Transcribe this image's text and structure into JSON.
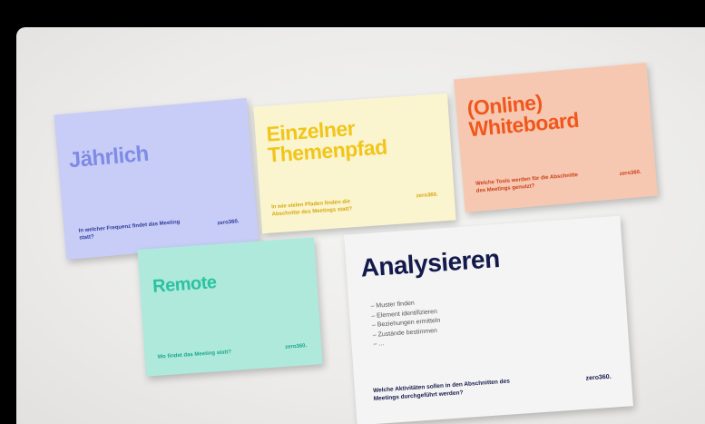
{
  "cards": [
    {
      "title": "Jährlich",
      "question": "In welcher Frequenz findet das Meeting statt?",
      "brand": "zero360.",
      "colors": {
        "background": "#c7cdf6",
        "accent": "#7f8be6"
      }
    },
    {
      "title": "Einzelner Themenpfad",
      "question": "In wie vielen Pfaden finden die Abschnitte des Meetings statt?",
      "brand": "zero360.",
      "colors": {
        "background": "#faf5cf",
        "accent": "#f1c51b"
      }
    },
    {
      "title": "(Online) Whiteboard",
      "question": "Welche Tools werden für die Abschnitte des Meetings genutzt?",
      "brand": "zero360.",
      "colors": {
        "background": "#f7c8b1",
        "accent": "#f0571c"
      }
    },
    {
      "title": "Remote",
      "question": "Wo findet das Meeting statt?",
      "brand": "zero360.",
      "colors": {
        "background": "#aee9dc",
        "accent": "#2bc29f"
      }
    },
    {
      "title": "Analysieren",
      "items": [
        "Muster finden",
        "Element identifizieren",
        "Beziehungen ermitteln",
        "Zustände bestimmen",
        "..."
      ],
      "question": "Welche Aktivitäten sollen in den Abschnitten des Meetings durchgeführt werden?",
      "brand": "zero360.",
      "colors": {
        "background": "#f4f4f4",
        "accent": "#141a4b"
      }
    }
  ]
}
